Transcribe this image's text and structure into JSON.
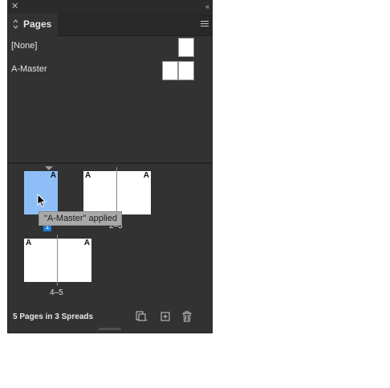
{
  "panel": {
    "close_glyph": "✕",
    "collapse_glyph": "‹‹",
    "tab_title": "Pages",
    "masters": [
      {
        "label": "[None]"
      },
      {
        "label": "A-Master"
      }
    ],
    "page_letter": "A",
    "selected_page_number": "1",
    "spreads": [
      {
        "label": "2–3"
      },
      {
        "label": "4–5"
      }
    ],
    "tooltip": "\"A-Master\" applied",
    "footer_text": "5 Pages in 3 Spreads",
    "colors": {
      "panel_bg": "#323232",
      "selected_page": "#8ebef7",
      "page_number_badge": "#1d7fe0"
    },
    "icons": {
      "close": "close-icon",
      "collapse": "double-chevron-left-icon",
      "tab": "up-down-arrows-icon",
      "menu": "hamburger-menu-icon",
      "edit_page_size": "edit-page-size-icon",
      "new_page": "new-page-icon",
      "delete_page": "trash-icon",
      "cursor": "mouse-pointer-icon"
    }
  }
}
